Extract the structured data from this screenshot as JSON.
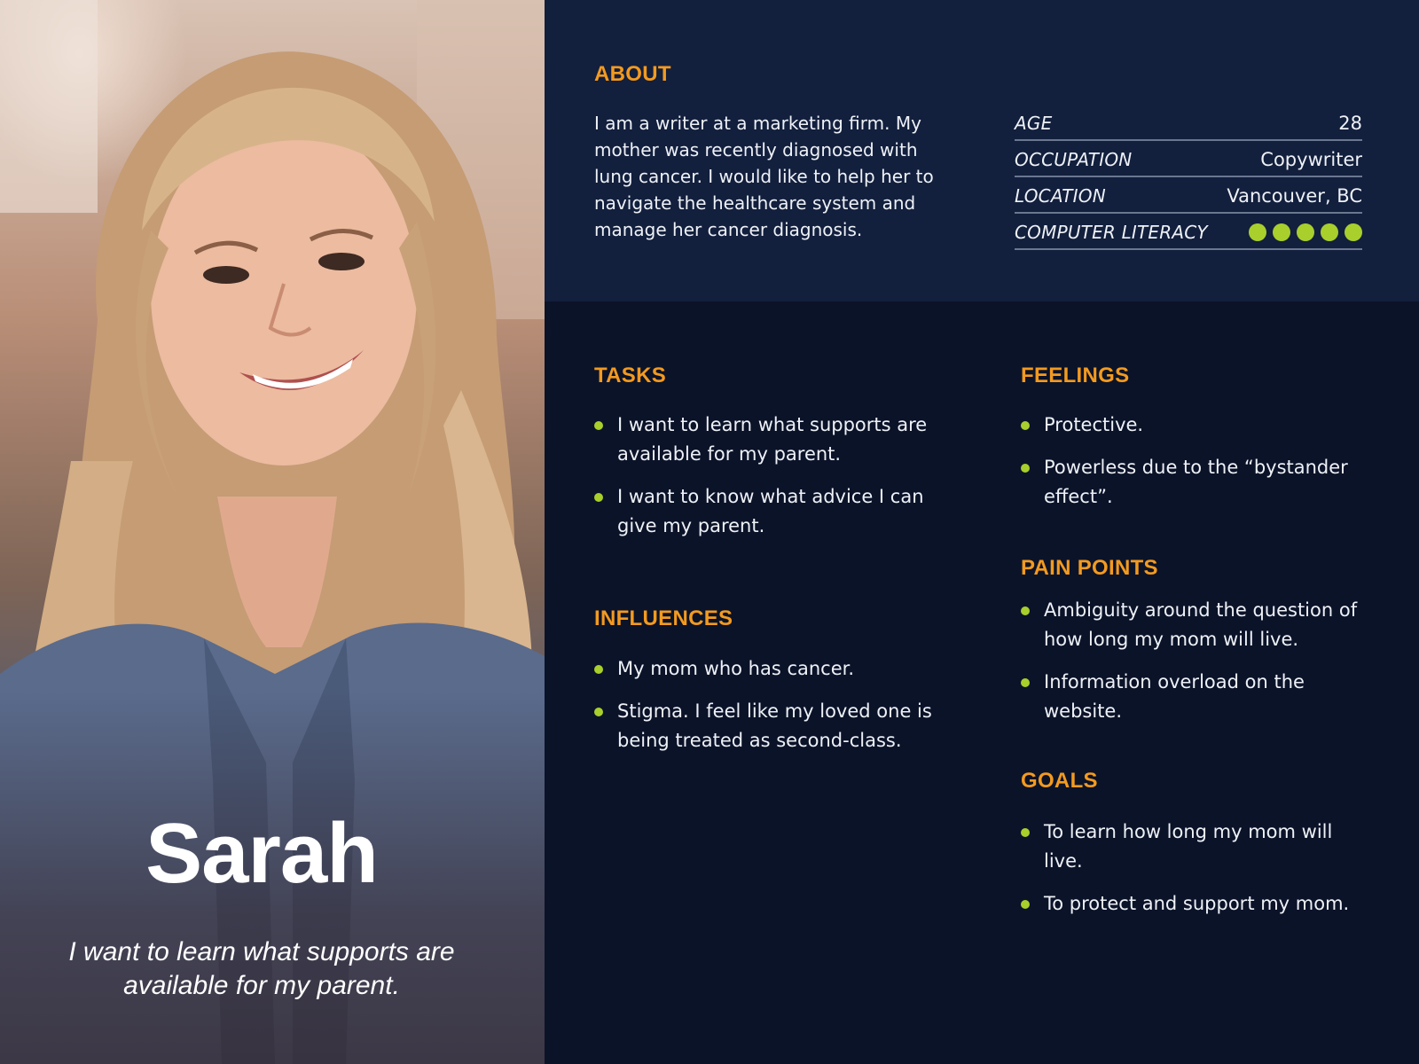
{
  "profile": {
    "name": "Sarah",
    "quote": "I want to learn what supports are available for my parent."
  },
  "about": {
    "heading": "ABOUT",
    "text": "I am a writer at a marketing firm. My mother was recently diagnosed with lung cancer. I would like to help her to navigate the healthcare system and manage her cancer diagnosis."
  },
  "stats": {
    "age_label": "AGE",
    "age_value": "28",
    "occupation_label": "OCCUPATION",
    "occupation_value": "Copywriter",
    "location_label": "LOCATION",
    "location_value": "Vancouver, BC",
    "literacy_label": "COMPUTER LITERACY",
    "literacy_level": 5,
    "literacy_max": 5
  },
  "tasks": {
    "heading": "TASKS",
    "items": [
      "I want to learn what supports are available for my parent.",
      "I want to know what advice I can give my parent."
    ]
  },
  "influences": {
    "heading": "INFLUENCES",
    "items": [
      "My mom who has cancer.",
      "Stigma. I feel like my loved one is being treated as second-class."
    ]
  },
  "feelings": {
    "heading": "FEELINGS",
    "items": [
      "Protective.",
      "Powerless due to the “bystander effect”."
    ]
  },
  "pain_points": {
    "heading": "PAIN POINTS",
    "items": [
      "Ambiguity around the question of how long my mom will live.",
      "Information overload on the website."
    ]
  },
  "goals": {
    "heading": "GOALS",
    "items": [
      "To learn how long my mom will live.",
      "To protect and support my mom."
    ]
  },
  "colors": {
    "accent_orange": "#f39a1f",
    "bullet_green": "#a8cf2c",
    "band_navy": "#121f3d",
    "background_navy": "#0b1329"
  }
}
